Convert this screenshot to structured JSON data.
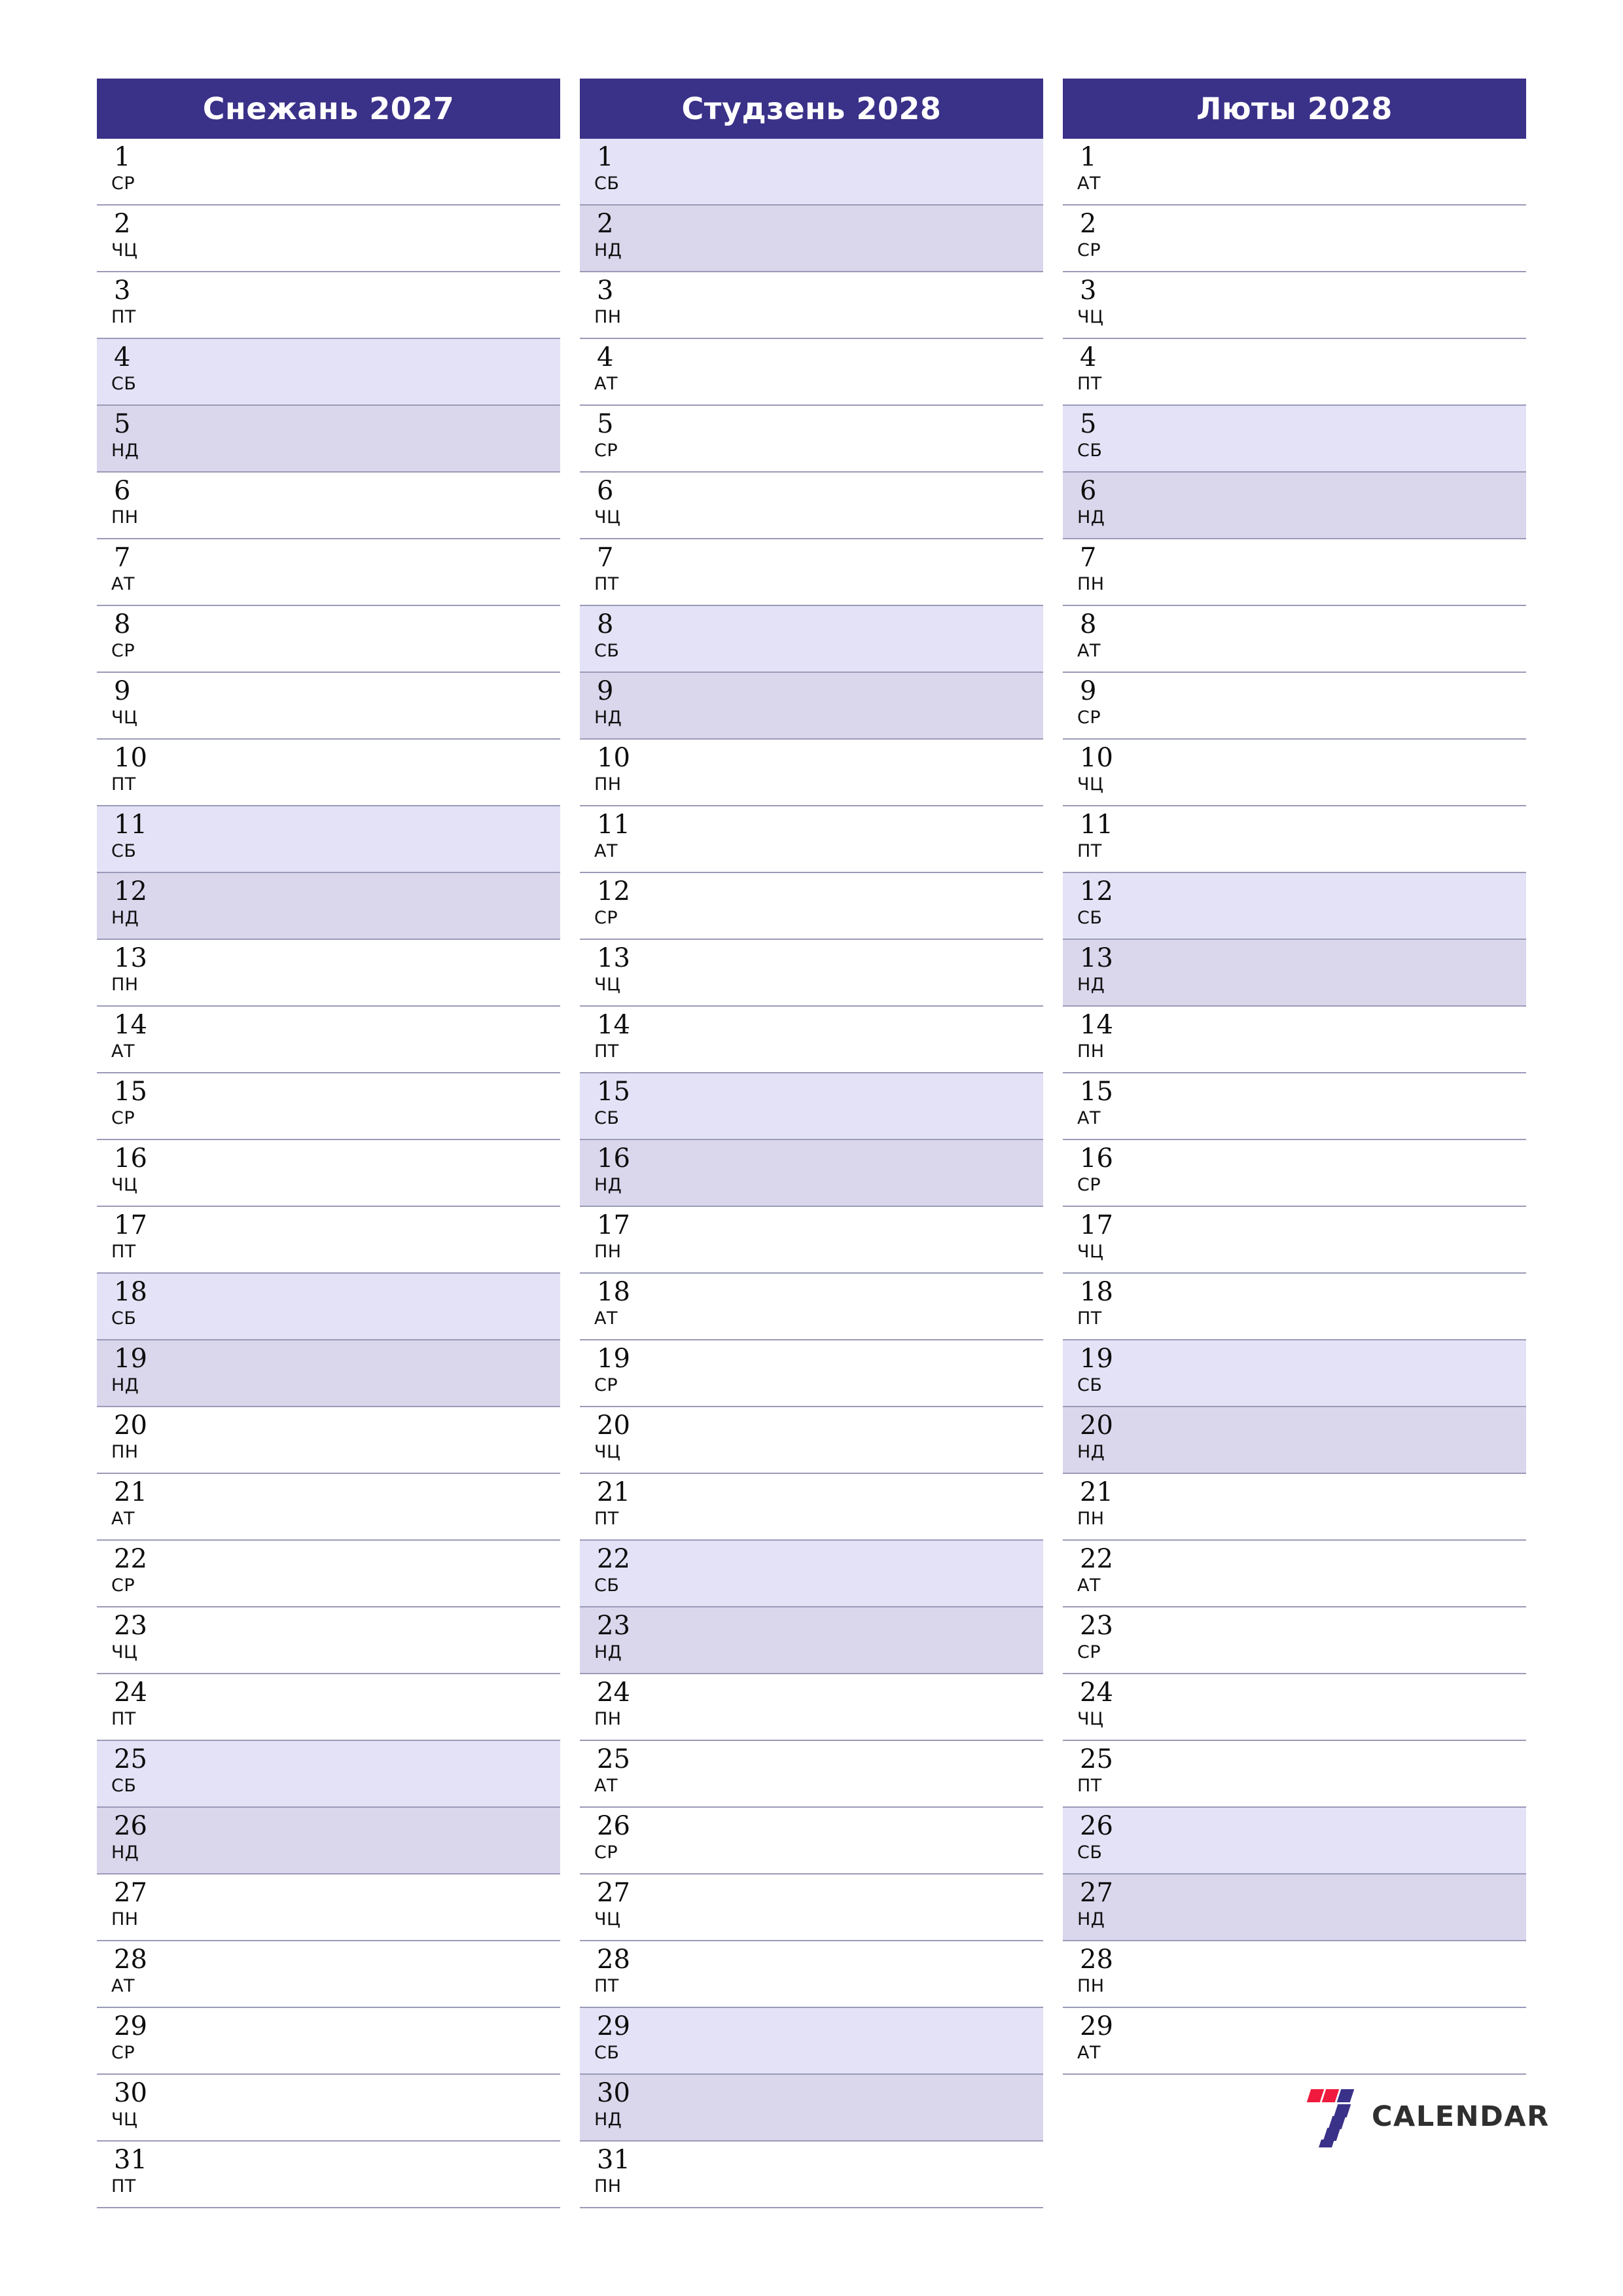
{
  "document": {
    "type": "monthly-planner",
    "language": "be",
    "orientation": "portrait",
    "months_shown": 3
  },
  "theme": {
    "header_bg": "#3a3189",
    "header_text": "#ffffff",
    "saturday_bg": "#e3e2f6",
    "sunday_bg": "#dad6ec",
    "row_line": "#9a9ab8",
    "page_bg": "#ffffff",
    "logo_red": "#ef1a3d",
    "logo_blue": "#3a3189",
    "logo_word": "#2f2f2f"
  },
  "weekday_labels": {
    "mon": "ПН",
    "tue": "АТ",
    "wed": "СР",
    "thu": "ЧЦ",
    "fri": "ПТ",
    "sat": "СБ",
    "sun": "НД"
  },
  "logo": {
    "name": "7calendar-logo",
    "wordmark": "CALENDAR",
    "mark_digit": "7"
  },
  "months": [
    {
      "title": "Снежань 2027",
      "month_name": "Снежань",
      "year": "2027",
      "days": [
        {
          "n": "1",
          "wd": "СР",
          "type": "weekday"
        },
        {
          "n": "2",
          "wd": "ЧЦ",
          "type": "weekday"
        },
        {
          "n": "3",
          "wd": "ПТ",
          "type": "weekday"
        },
        {
          "n": "4",
          "wd": "СБ",
          "type": "sat"
        },
        {
          "n": "5",
          "wd": "НД",
          "type": "sun"
        },
        {
          "n": "6",
          "wd": "ПН",
          "type": "weekday"
        },
        {
          "n": "7",
          "wd": "АТ",
          "type": "weekday"
        },
        {
          "n": "8",
          "wd": "СР",
          "type": "weekday"
        },
        {
          "n": "9",
          "wd": "ЧЦ",
          "type": "weekday"
        },
        {
          "n": "10",
          "wd": "ПТ",
          "type": "weekday"
        },
        {
          "n": "11",
          "wd": "СБ",
          "type": "sat"
        },
        {
          "n": "12",
          "wd": "НД",
          "type": "sun"
        },
        {
          "n": "13",
          "wd": "ПН",
          "type": "weekday"
        },
        {
          "n": "14",
          "wd": "АТ",
          "type": "weekday"
        },
        {
          "n": "15",
          "wd": "СР",
          "type": "weekday"
        },
        {
          "n": "16",
          "wd": "ЧЦ",
          "type": "weekday"
        },
        {
          "n": "17",
          "wd": "ПТ",
          "type": "weekday"
        },
        {
          "n": "18",
          "wd": "СБ",
          "type": "sat"
        },
        {
          "n": "19",
          "wd": "НД",
          "type": "sun"
        },
        {
          "n": "20",
          "wd": "ПН",
          "type": "weekday"
        },
        {
          "n": "21",
          "wd": "АТ",
          "type": "weekday"
        },
        {
          "n": "22",
          "wd": "СР",
          "type": "weekday"
        },
        {
          "n": "23",
          "wd": "ЧЦ",
          "type": "weekday"
        },
        {
          "n": "24",
          "wd": "ПТ",
          "type": "weekday"
        },
        {
          "n": "25",
          "wd": "СБ",
          "type": "sat"
        },
        {
          "n": "26",
          "wd": "НД",
          "type": "sun"
        },
        {
          "n": "27",
          "wd": "ПН",
          "type": "weekday"
        },
        {
          "n": "28",
          "wd": "АТ",
          "type": "weekday"
        },
        {
          "n": "29",
          "wd": "СР",
          "type": "weekday"
        },
        {
          "n": "30",
          "wd": "ЧЦ",
          "type": "weekday"
        },
        {
          "n": "31",
          "wd": "ПТ",
          "type": "weekday"
        }
      ]
    },
    {
      "title": "Студзень 2028",
      "month_name": "Студзень",
      "year": "2028",
      "days": [
        {
          "n": "1",
          "wd": "СБ",
          "type": "sat"
        },
        {
          "n": "2",
          "wd": "НД",
          "type": "sun"
        },
        {
          "n": "3",
          "wd": "ПН",
          "type": "weekday"
        },
        {
          "n": "4",
          "wd": "АТ",
          "type": "weekday"
        },
        {
          "n": "5",
          "wd": "СР",
          "type": "weekday"
        },
        {
          "n": "6",
          "wd": "ЧЦ",
          "type": "weekday"
        },
        {
          "n": "7",
          "wd": "ПТ",
          "type": "weekday"
        },
        {
          "n": "8",
          "wd": "СБ",
          "type": "sat"
        },
        {
          "n": "9",
          "wd": "НД",
          "type": "sun"
        },
        {
          "n": "10",
          "wd": "ПН",
          "type": "weekday"
        },
        {
          "n": "11",
          "wd": "АТ",
          "type": "weekday"
        },
        {
          "n": "12",
          "wd": "СР",
          "type": "weekday"
        },
        {
          "n": "13",
          "wd": "ЧЦ",
          "type": "weekday"
        },
        {
          "n": "14",
          "wd": "ПТ",
          "type": "weekday"
        },
        {
          "n": "15",
          "wd": "СБ",
          "type": "sat"
        },
        {
          "n": "16",
          "wd": "НД",
          "type": "sun"
        },
        {
          "n": "17",
          "wd": "ПН",
          "type": "weekday"
        },
        {
          "n": "18",
          "wd": "АТ",
          "type": "weekday"
        },
        {
          "n": "19",
          "wd": "СР",
          "type": "weekday"
        },
        {
          "n": "20",
          "wd": "ЧЦ",
          "type": "weekday"
        },
        {
          "n": "21",
          "wd": "ПТ",
          "type": "weekday"
        },
        {
          "n": "22",
          "wd": "СБ",
          "type": "sat"
        },
        {
          "n": "23",
          "wd": "НД",
          "type": "sun"
        },
        {
          "n": "24",
          "wd": "ПН",
          "type": "weekday"
        },
        {
          "n": "25",
          "wd": "АТ",
          "type": "weekday"
        },
        {
          "n": "26",
          "wd": "СР",
          "type": "weekday"
        },
        {
          "n": "27",
          "wd": "ЧЦ",
          "type": "weekday"
        },
        {
          "n": "28",
          "wd": "ПТ",
          "type": "weekday"
        },
        {
          "n": "29",
          "wd": "СБ",
          "type": "sat"
        },
        {
          "n": "30",
          "wd": "НД",
          "type": "sun"
        },
        {
          "n": "31",
          "wd": "ПН",
          "type": "weekday"
        }
      ]
    },
    {
      "title": "Люты 2028",
      "month_name": "Люты",
      "year": "2028",
      "days": [
        {
          "n": "1",
          "wd": "АТ",
          "type": "weekday"
        },
        {
          "n": "2",
          "wd": "СР",
          "type": "weekday"
        },
        {
          "n": "3",
          "wd": "ЧЦ",
          "type": "weekday"
        },
        {
          "n": "4",
          "wd": "ПТ",
          "type": "weekday"
        },
        {
          "n": "5",
          "wd": "СБ",
          "type": "sat"
        },
        {
          "n": "6",
          "wd": "НД",
          "type": "sun"
        },
        {
          "n": "7",
          "wd": "ПН",
          "type": "weekday"
        },
        {
          "n": "8",
          "wd": "АТ",
          "type": "weekday"
        },
        {
          "n": "9",
          "wd": "СР",
          "type": "weekday"
        },
        {
          "n": "10",
          "wd": "ЧЦ",
          "type": "weekday"
        },
        {
          "n": "11",
          "wd": "ПТ",
          "type": "weekday"
        },
        {
          "n": "12",
          "wd": "СБ",
          "type": "sat"
        },
        {
          "n": "13",
          "wd": "НД",
          "type": "sun"
        },
        {
          "n": "14",
          "wd": "ПН",
          "type": "weekday"
        },
        {
          "n": "15",
          "wd": "АТ",
          "type": "weekday"
        },
        {
          "n": "16",
          "wd": "СР",
          "type": "weekday"
        },
        {
          "n": "17",
          "wd": "ЧЦ",
          "type": "weekday"
        },
        {
          "n": "18",
          "wd": "ПТ",
          "type": "weekday"
        },
        {
          "n": "19",
          "wd": "СБ",
          "type": "sat"
        },
        {
          "n": "20",
          "wd": "НД",
          "type": "sun"
        },
        {
          "n": "21",
          "wd": "ПН",
          "type": "weekday"
        },
        {
          "n": "22",
          "wd": "АТ",
          "type": "weekday"
        },
        {
          "n": "23",
          "wd": "СР",
          "type": "weekday"
        },
        {
          "n": "24",
          "wd": "ЧЦ",
          "type": "weekday"
        },
        {
          "n": "25",
          "wd": "ПТ",
          "type": "weekday"
        },
        {
          "n": "26",
          "wd": "СБ",
          "type": "sat"
        },
        {
          "n": "27",
          "wd": "НД",
          "type": "sun"
        },
        {
          "n": "28",
          "wd": "ПН",
          "type": "weekday"
        },
        {
          "n": "29",
          "wd": "АТ",
          "type": "weekday"
        }
      ]
    }
  ]
}
